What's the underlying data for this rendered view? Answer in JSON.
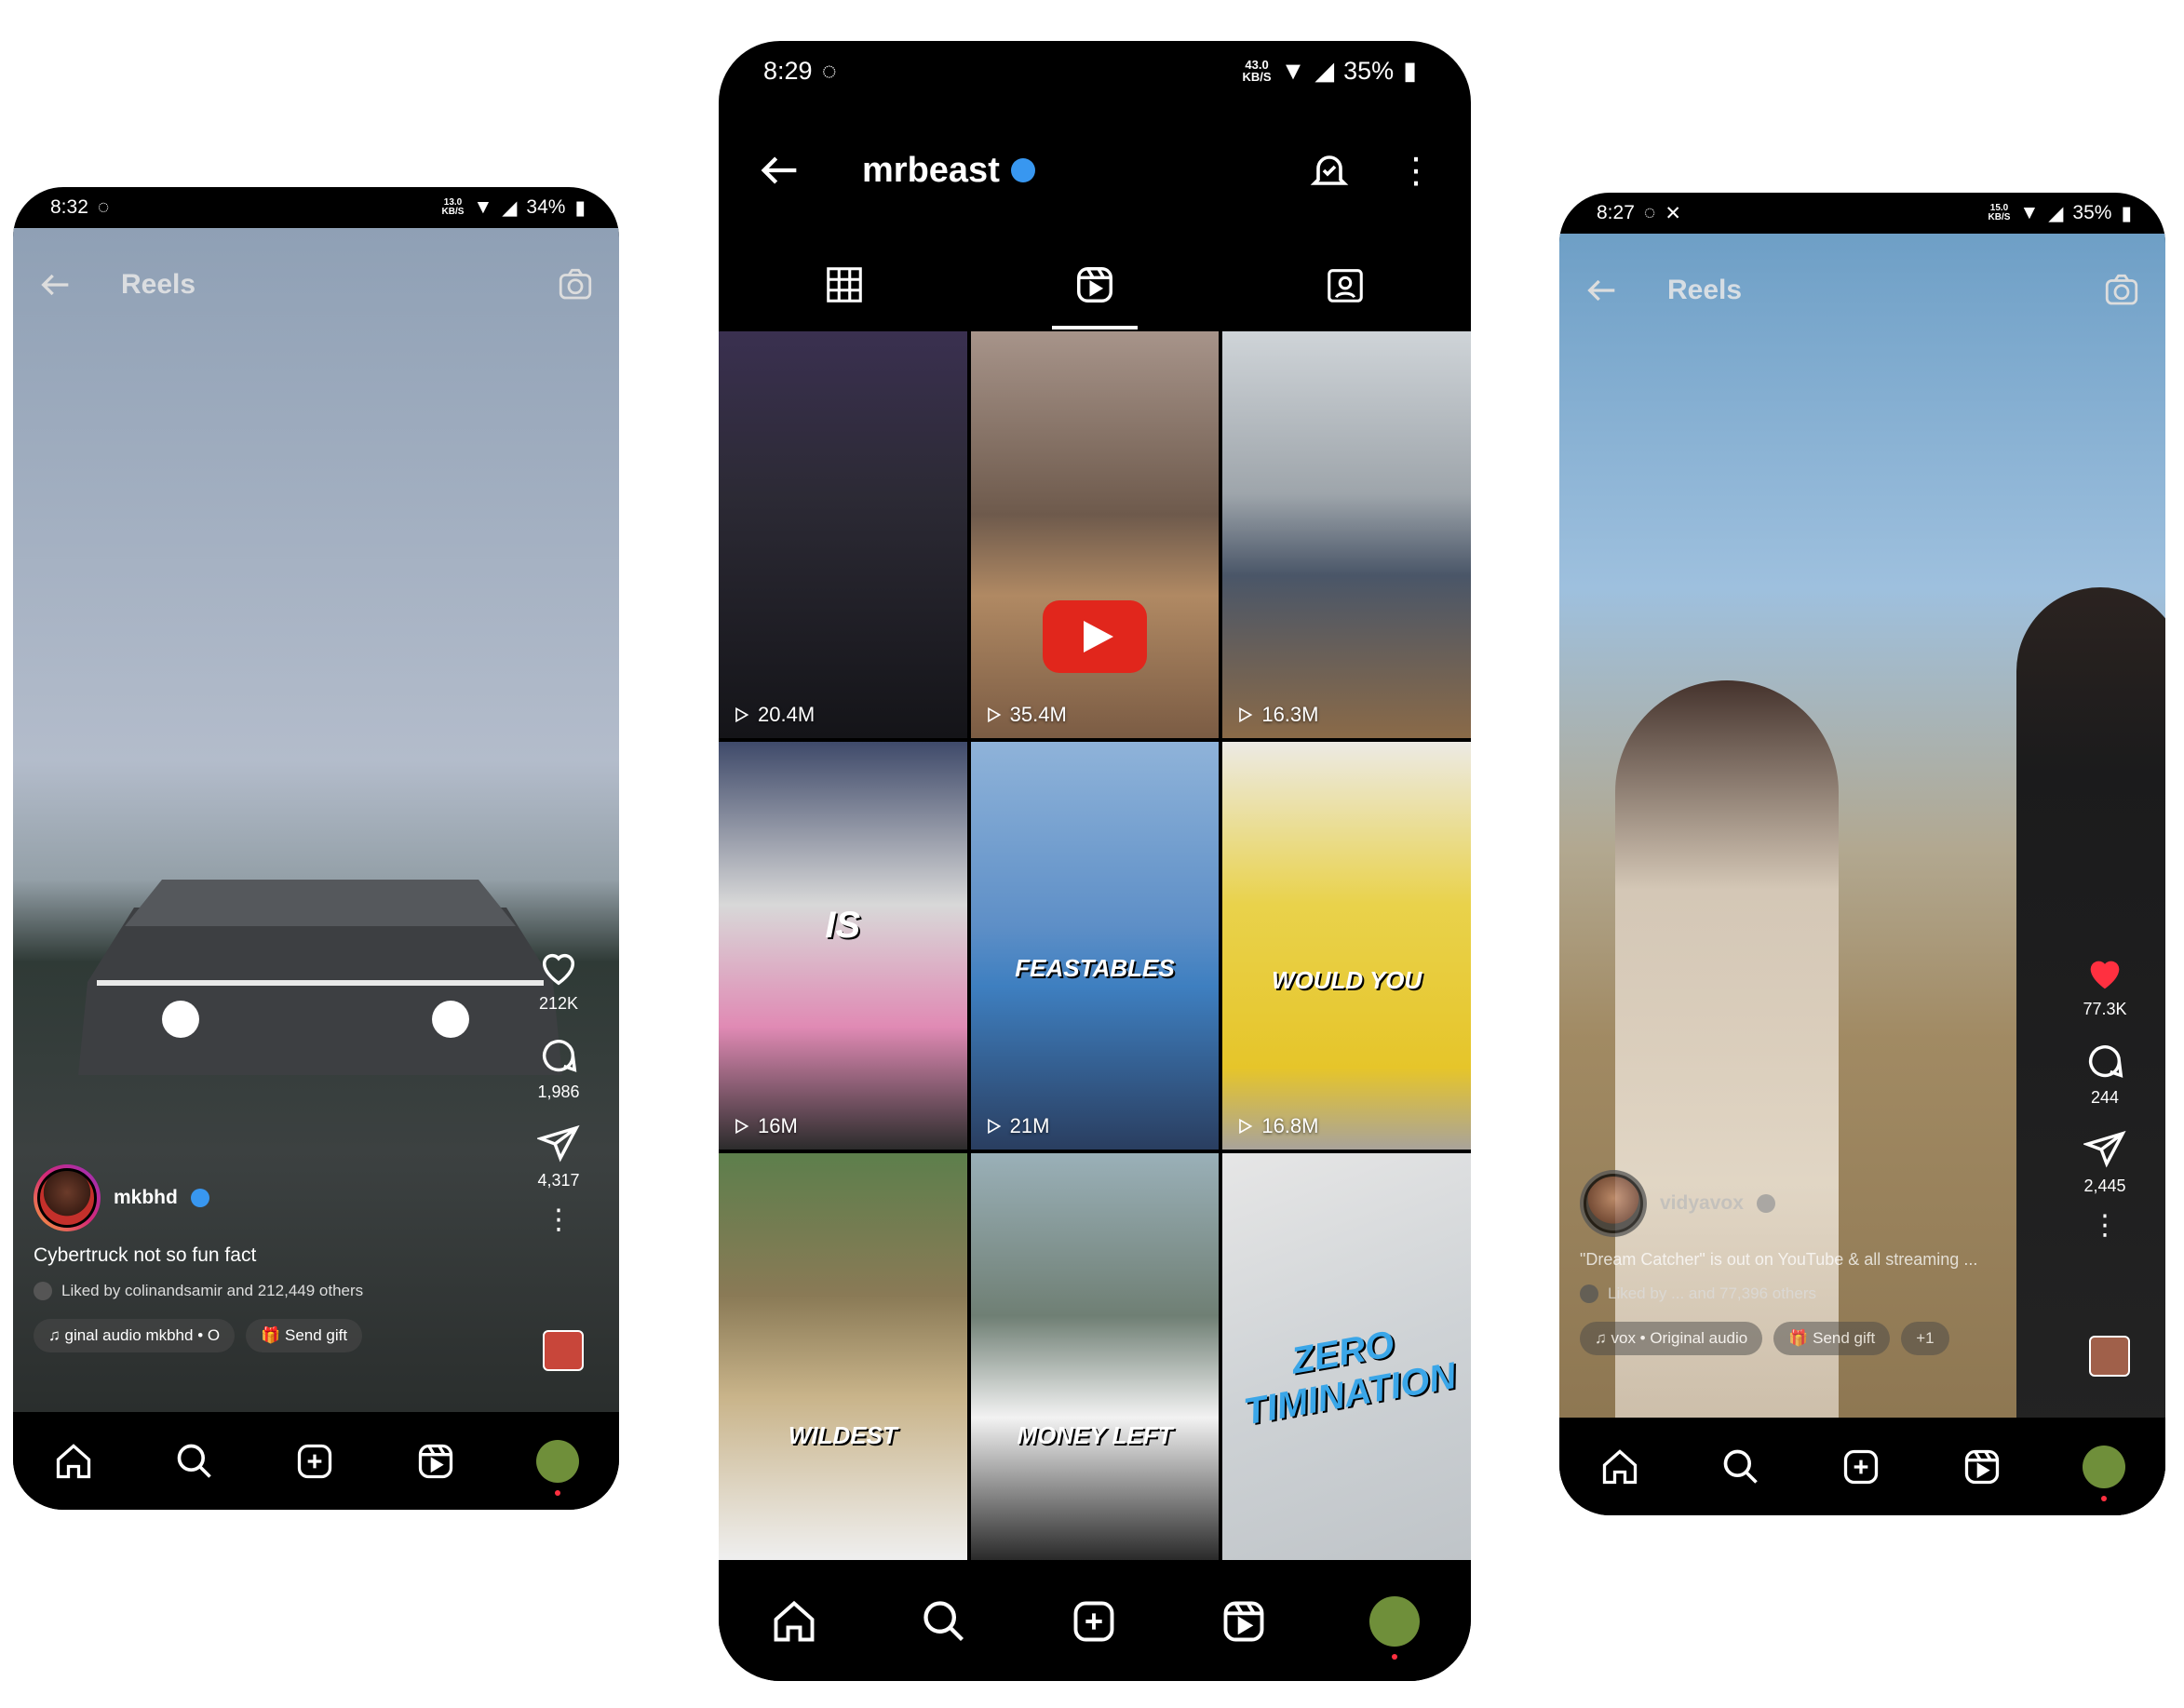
{
  "phone_left": {
    "status": {
      "time": "8:32",
      "speed_value": "13.0",
      "speed_unit": "KB/S",
      "battery": "34%"
    },
    "header": {
      "title": "Reels"
    },
    "actions": {
      "likes": "212K",
      "comments": "1,986",
      "shares": "4,317"
    },
    "post": {
      "username": "mkbhd",
      "caption": "Cybertruck not so fun fact",
      "liked_by": "Liked by colinandsamir and 212,449 others",
      "audio": "ginal audio    mkbhd • O",
      "gift": "Send gift"
    }
  },
  "phone_mid": {
    "status": {
      "time": "8:29",
      "speed_value": "43.0",
      "speed_unit": "KB/S",
      "battery": "35%"
    },
    "profile": {
      "username": "mrbeast"
    },
    "reels": [
      {
        "views": "20.4M"
      },
      {
        "views": "35.4M"
      },
      {
        "views": "16.3M"
      },
      {
        "views": "16M",
        "overlay": "IS"
      },
      {
        "views": "21M",
        "overlay": "FEASTABLES"
      },
      {
        "views": "16.8M",
        "overlay": "WOULD YOU"
      },
      {
        "overlay": "WILDEST"
      },
      {
        "overlay": "MONEY LEFT"
      },
      {
        "overlay": "ZERO TIMINATION"
      }
    ]
  },
  "phone_right": {
    "status": {
      "time": "8:27",
      "speed_value": "15.0",
      "speed_unit": "KB/S",
      "battery": "35%"
    },
    "header": {
      "title": "Reels"
    },
    "actions": {
      "likes": "77.3K",
      "comments": "244",
      "shares": "2,445"
    },
    "post": {
      "username": "vidyavox",
      "caption": "\"Dream Catcher\" is out on YouTube & all streaming ...",
      "liked_by": "Liked by ... and 77,396 others",
      "audio": "vox • Original audio",
      "gift": "Send gift",
      "extra": "+1"
    }
  },
  "colors": {
    "like_red": "#ff3040",
    "verified_blue": "#3897f0",
    "youtube_red": "#e1261c"
  }
}
